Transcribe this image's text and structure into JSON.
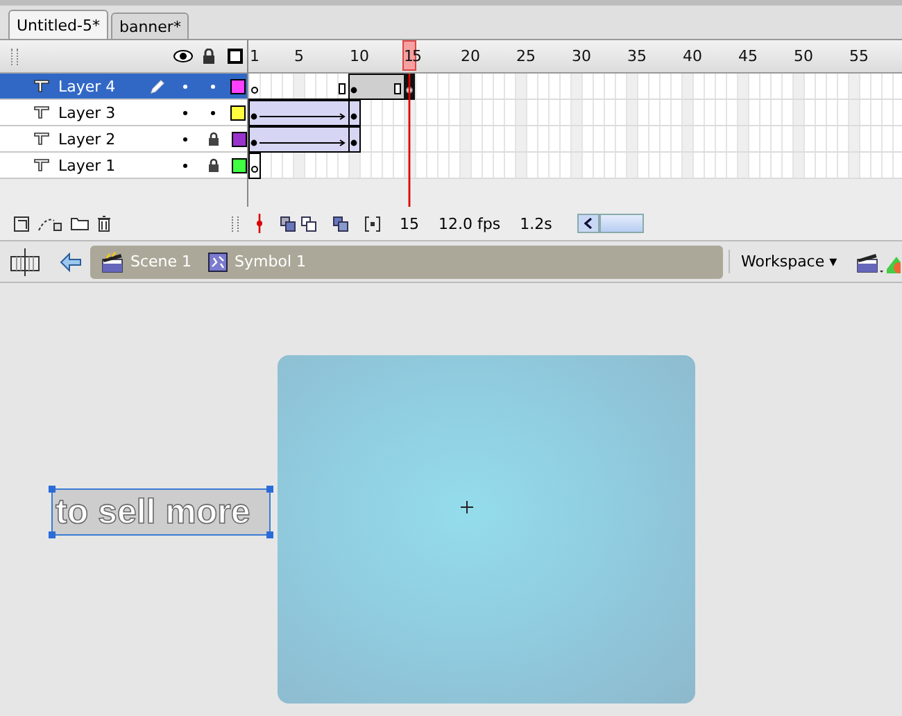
{
  "tabs": [
    {
      "label": "Untitled-5*",
      "selected": true
    },
    {
      "label": "banner*",
      "selected": false
    }
  ],
  "ruler": [
    {
      "label": "1",
      "selected": false
    },
    {
      "label": "5",
      "selected": false
    },
    {
      "label": "10",
      "selected": false
    },
    {
      "label": "15",
      "selected": true
    },
    {
      "label": "20",
      "selected": false
    },
    {
      "label": "25",
      "selected": false
    },
    {
      "label": "30",
      "selected": false
    },
    {
      "label": "35",
      "selected": false
    },
    {
      "label": "40",
      "selected": false
    },
    {
      "label": "45",
      "selected": false
    },
    {
      "label": "50",
      "selected": false
    },
    {
      "label": "55",
      "selected": false
    }
  ],
  "layers": [
    {
      "name": "Layer 4",
      "selected": true,
      "locked": false,
      "color": "#ff40ff",
      "kind": "partial"
    },
    {
      "name": "Layer 3",
      "selected": false,
      "locked": false,
      "color": "#ffff40",
      "kind": "tween"
    },
    {
      "name": "Layer 2",
      "selected": false,
      "locked": true,
      "color": "#9933cc",
      "kind": "tween"
    },
    {
      "name": "Layer 1",
      "selected": false,
      "locked": true,
      "color": "#40ff40",
      "kind": "static"
    }
  ],
  "status": {
    "frame": "15",
    "rate": "12.0 fps",
    "time": "1.2s"
  },
  "breadcrumbs": [
    {
      "label": "Scene 1",
      "kind": "scene"
    },
    {
      "label": "Symbol 1",
      "kind": "symbol"
    }
  ],
  "workspace": "Workspace ▾",
  "stage_text": "to sell more"
}
